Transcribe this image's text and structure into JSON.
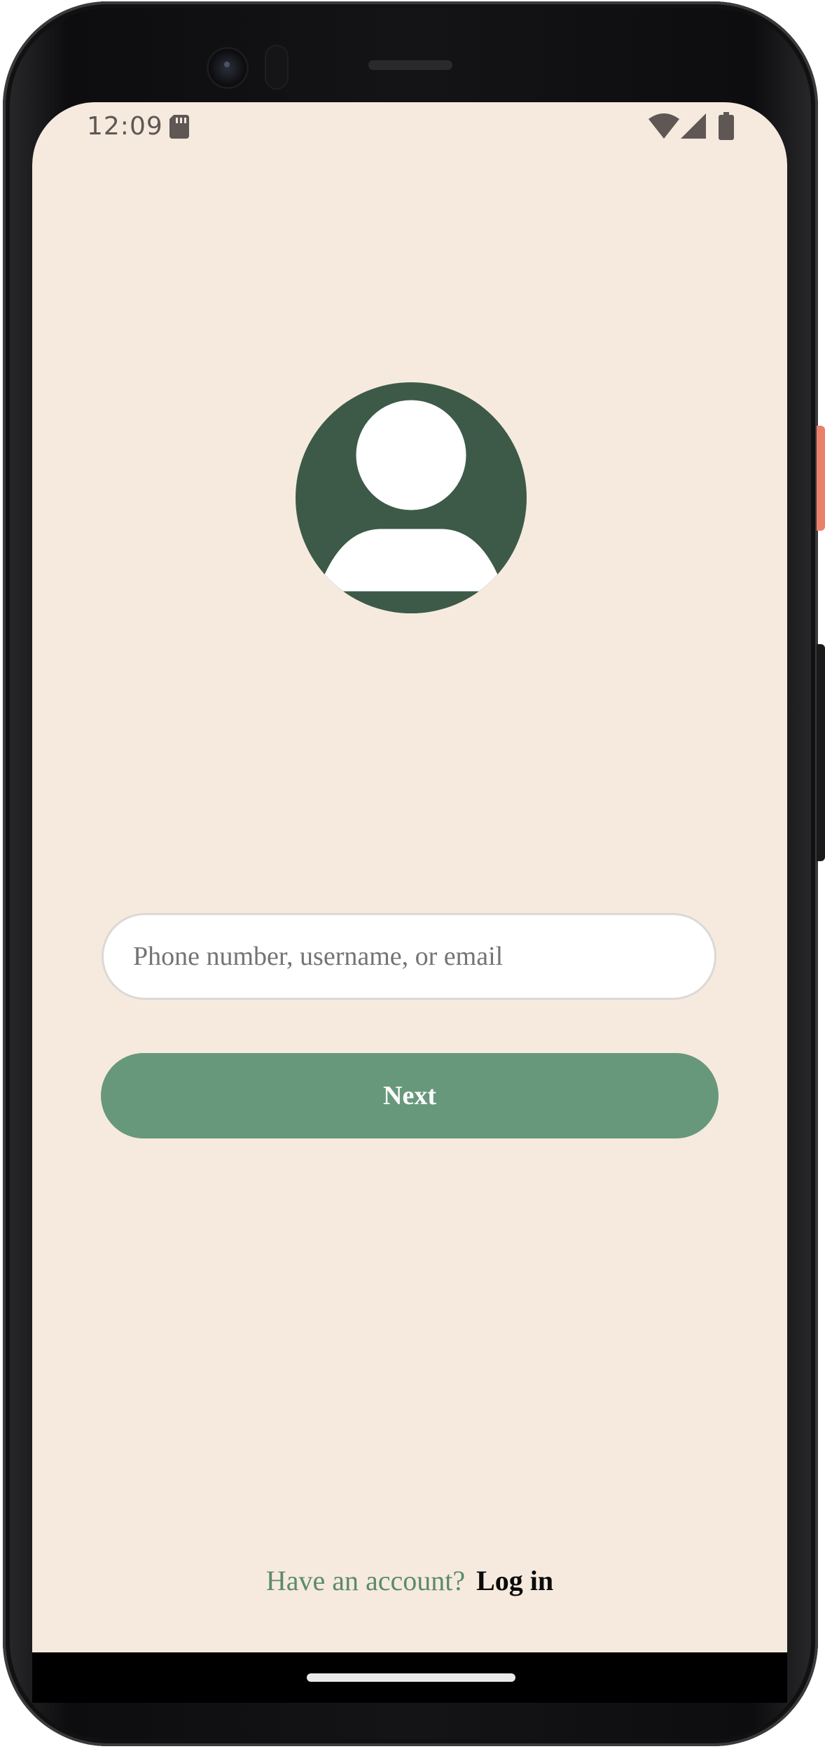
{
  "status_bar": {
    "time": "12:09"
  },
  "form": {
    "identifier_placeholder": "Phone number, username, or email",
    "identifier_value": "",
    "next_label": "Next"
  },
  "footer": {
    "prompt": "Have an account?",
    "login_label": "Log in"
  },
  "colors": {
    "background": "#f6eadf",
    "avatar_bg": "#3d5a48",
    "button": "#68987b",
    "prompt_text": "#5c8a6b"
  },
  "icons": [
    "sd-card-icon",
    "wifi-icon",
    "cell-signal-icon",
    "battery-icon",
    "user-avatar-icon"
  ]
}
